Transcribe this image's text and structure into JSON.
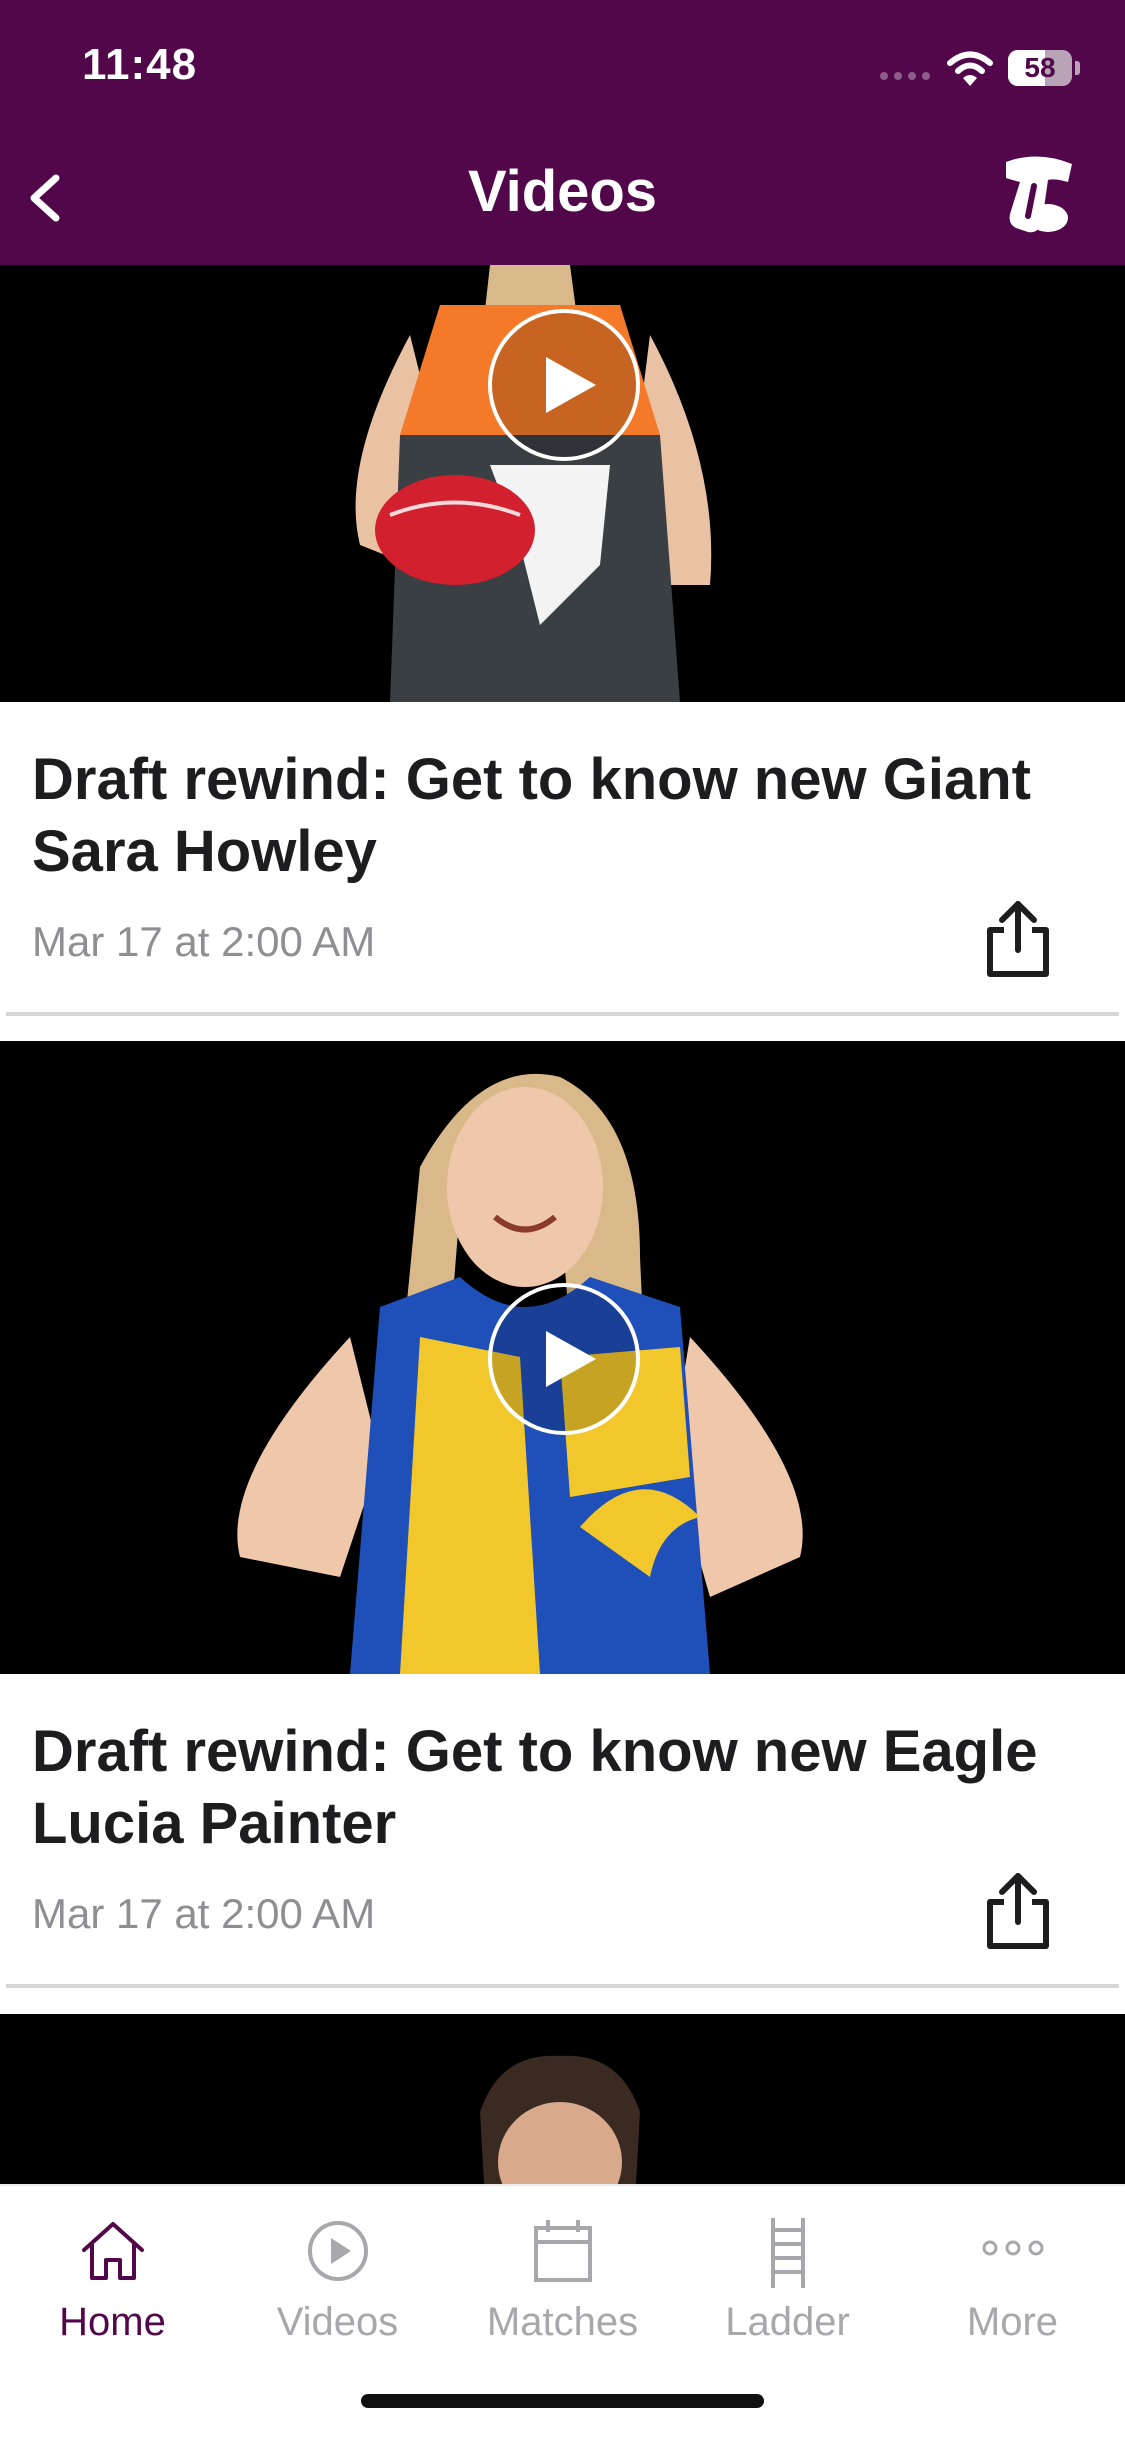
{
  "status_bar": {
    "time": "11:48",
    "battery": "58",
    "battery_level": 0.58
  },
  "header": {
    "title": "Videos",
    "back_icon": "chevron-left-icon",
    "logo_icon": "telstra-logo-icon"
  },
  "videos": [
    {
      "title": "Draft rewind: Get to know new Giant Sara Howley",
      "date": "Mar 17 at 2:00 AM",
      "jersey_colors": [
        "#f47a29",
        "#3a3f44"
      ]
    },
    {
      "title": "Draft rewind: Get to know new Eagle Lucia Painter",
      "date": "Mar 17 at 2:00 AM",
      "jersey_colors": [
        "#1f4fb8",
        "#f2c72b"
      ]
    }
  ],
  "tab_bar": {
    "tabs": [
      {
        "label": "Home",
        "icon": "home-icon",
        "active": true
      },
      {
        "label": "Videos",
        "icon": "play-circle-icon",
        "active": false
      },
      {
        "label": "Matches",
        "icon": "calendar-icon",
        "active": false
      },
      {
        "label": "Ladder",
        "icon": "ladder-icon",
        "active": false
      },
      {
        "label": "More",
        "icon": "more-dots-icon",
        "active": false
      }
    ]
  },
  "colors": {
    "brand": "#51074a",
    "inactive": "#a7a7ac",
    "text": "#1d1d1f",
    "muted": "#8e8e93"
  }
}
